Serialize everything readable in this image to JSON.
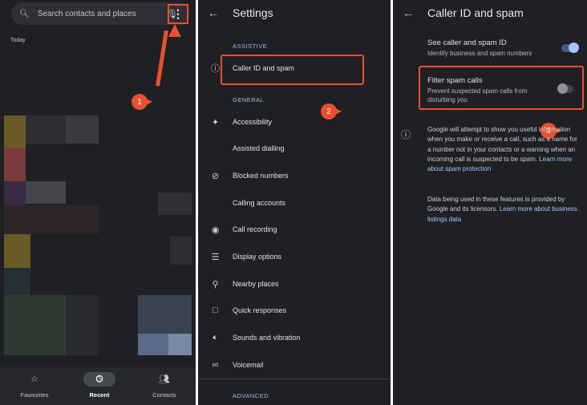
{
  "dialer": {
    "search_placeholder": "Search contacts and places",
    "section": "Today",
    "nav": [
      {
        "label": "Favourites",
        "icon": "star-icon"
      },
      {
        "label": "Recent",
        "icon": "clock-icon",
        "active": true
      },
      {
        "label": "Contacts",
        "icon": "contacts-icon"
      }
    ]
  },
  "settings": {
    "title": "Settings",
    "sections": {
      "assistive": "ASSISTIVE",
      "general": "GENERAL",
      "advanced": "ADVANCED"
    },
    "items": [
      "Caller ID and spam",
      "Accessibility",
      "Assisted dialling",
      "Blocked numbers",
      "Calling accounts",
      "Call recording",
      "Display options",
      "Nearby places",
      "Quick responses",
      "Sounds and vibration",
      "Voicemail"
    ]
  },
  "caller_id": {
    "title": "Caller ID and spam",
    "see": {
      "title": "See caller and spam ID",
      "subtitle": "Identify business and spam numbers",
      "enabled": true
    },
    "filter": {
      "title": "Filter spam calls",
      "subtitle": "Prevent suspected spam calls from disturbing you",
      "enabled": false
    },
    "info1": "Google will attempt to show you useful information when you make or receive a call, such as a name for a number not in your contacts or a warning when an incoming call is suspected to be spam.",
    "link1": "Learn more about spam protection",
    "info2": "Data being used in these features is provided by Google and its licensors.",
    "link2": "Learn more about business listings data"
  },
  "steps": [
    "1",
    "2",
    "3"
  ],
  "colors": {
    "highlight": "#e8502e",
    "accent": "#a8c4ff"
  }
}
